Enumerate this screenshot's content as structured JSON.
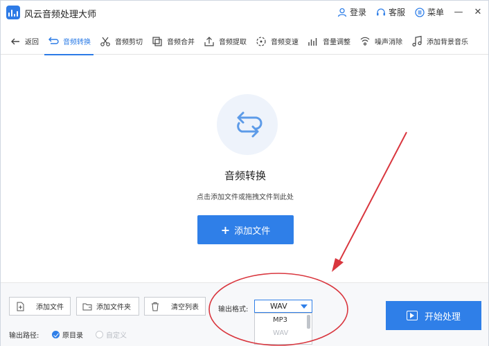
{
  "app": {
    "title": "风云音频处理大师"
  },
  "titlebar": {
    "login": "登录",
    "service": "客服",
    "menu": "菜单",
    "minimize": "—",
    "close": "✕"
  },
  "toolbar": {
    "back": "返回",
    "items": [
      {
        "label": "音频转换",
        "icon": "convert-icon",
        "active": true
      },
      {
        "label": "音频剪切",
        "icon": "scissors-icon"
      },
      {
        "label": "音频合并",
        "icon": "merge-icon"
      },
      {
        "label": "音频提取",
        "icon": "extract-icon"
      },
      {
        "label": "音频变速",
        "icon": "speed-icon"
      },
      {
        "label": "音量调整",
        "icon": "volume-bars-icon"
      },
      {
        "label": "噪声消除",
        "icon": "noise-icon"
      },
      {
        "label": "添加背景音乐",
        "icon": "music-note-icon"
      }
    ]
  },
  "main": {
    "title": "音频转换",
    "subtitle": "点击添加文件或拖拽文件到此处",
    "add_button": "添加文件"
  },
  "bottom": {
    "add_file": "添加文件",
    "add_folder": "添加文件夹",
    "clear_list": "清空列表",
    "format_label": "输出格式:",
    "format_selected": "WAV",
    "format_options": [
      "MP3",
      "WAV"
    ],
    "start": "开始处理",
    "output_path_label": "输出路径:",
    "path_original": "原目录",
    "path_custom": "自定义"
  },
  "colors": {
    "accent": "#2f7fe8",
    "annotation": "#d9363e"
  }
}
